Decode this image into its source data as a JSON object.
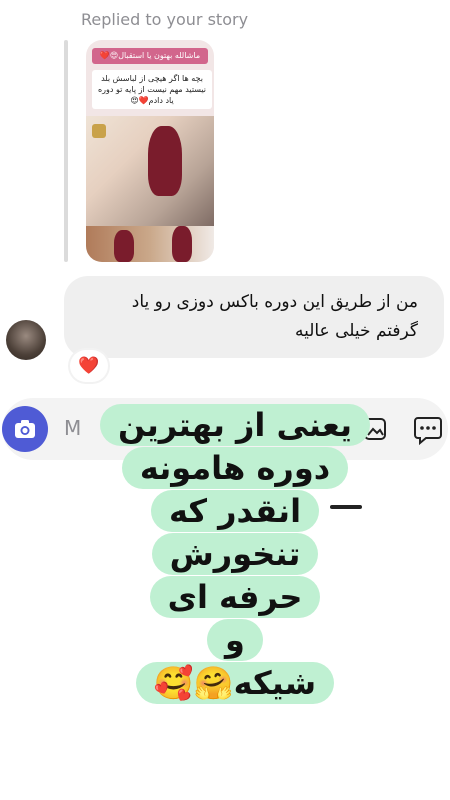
{
  "thread": {
    "replied_label": "Replied to your story",
    "story": {
      "banner": "ماشالله بهتون یا استقبال😍❤️",
      "caption": "بچه ها اگر هیچی از لباسش بلد نیستید مهم نیست از پایه تو دوره یاد دادم❤️😍"
    },
    "message": {
      "line1": "من از طریق این دوره باکس دوزی رو یاد",
      "line2": "گرفتم خیلی عالیه"
    },
    "reaction": "❤️"
  },
  "composer": {
    "camera_icon": "camera-icon",
    "placeholder_fragment": "M",
    "gallery_icon": "gallery-icon",
    "sticker_icon": "message-more-icon"
  },
  "overlay": {
    "lines": [
      "یعنی از بهترین",
      "دوره هامونه",
      "انقدر که",
      "تنخورش",
      "حرفه ای",
      "و",
      "شیکه🤗🥰"
    ]
  },
  "colors": {
    "accent": "#4f5bd5",
    "overlay_bg": "#bff0d2",
    "bubble_bg": "#efefef"
  }
}
